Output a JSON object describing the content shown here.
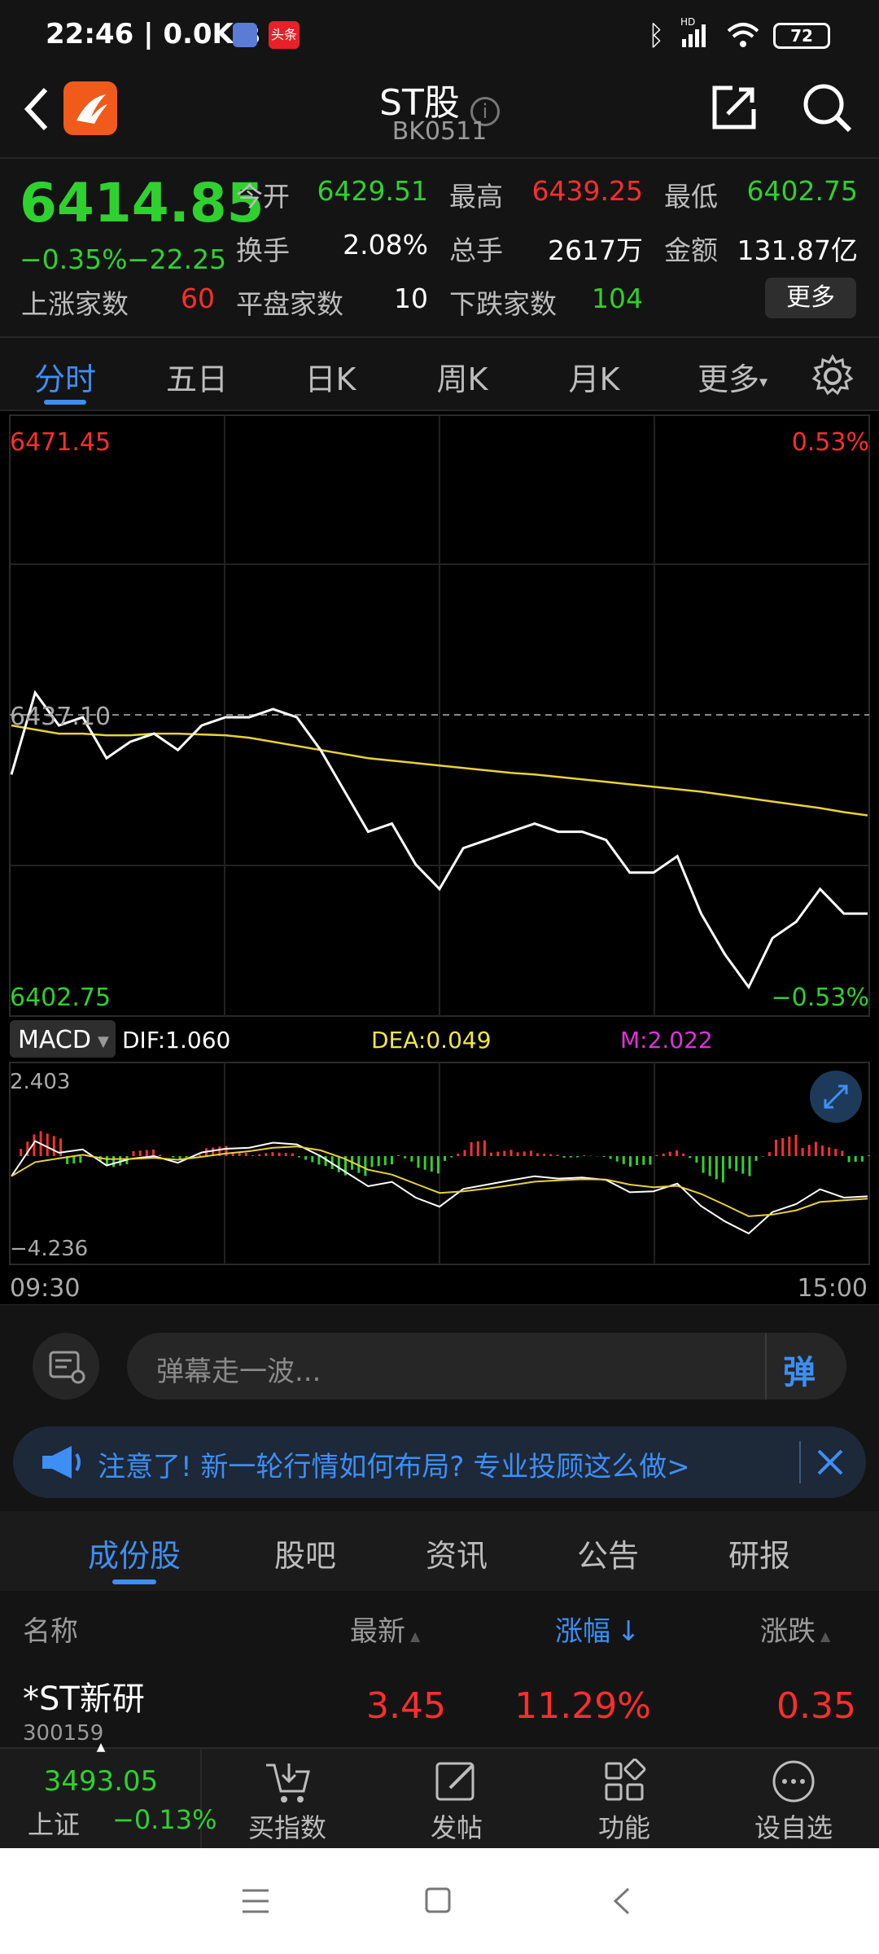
{
  "status_bar": {
    "time": "22:46",
    "speed": "0.0K/s",
    "app_badge": "头条",
    "battery": "72",
    "bluetooth_icon": "bluetooth-icon",
    "signal_icon": "signal-icon",
    "hd_label": "HD",
    "wifi_icon": "wifi-icon"
  },
  "header": {
    "title": "ST股",
    "code": "BK0511",
    "back_icon": "back-arrow-icon",
    "logo_icon": "app-logo-icon",
    "info_icon": "info-icon",
    "share_icon": "share-icon",
    "search_icon": "search-icon"
  },
  "quote": {
    "price": "6414.85",
    "change_pct": "−0.35%",
    "change": "−22.25",
    "open_label": "今开",
    "open": "6429.51",
    "high_label": "最高",
    "high": "6439.25",
    "low_label": "最低",
    "low": "6402.75",
    "turnover_label": "换手",
    "turnover": "2.08%",
    "volume_label": "总手",
    "volume": "2617万",
    "amount_label": "金额",
    "amount": "131.87亿",
    "up_label": "上涨家数",
    "up": "60",
    "flat_label": "平盘家数",
    "flat": "10",
    "down_label": "下跌家数",
    "down": "104",
    "more_button": "更多"
  },
  "tabs": {
    "items": [
      "分时",
      "五日",
      "日K",
      "周K",
      "月K",
      "更多"
    ],
    "active": 0,
    "settings_icon": "gear-icon"
  },
  "chart": {
    "max_price": "6471.45",
    "max_pct": "0.53%",
    "prev_close": "6437.10",
    "min_price": "6402.75",
    "min_pct": "−0.53%",
    "macd_label": "MACD",
    "dif": "DIF:1.060",
    "dea": "DEA:0.049",
    "m": "M:2.022",
    "macd_max": "2.403",
    "macd_min": "−4.236",
    "time_start": "09:30",
    "time_end": "15:00",
    "expand_icon": "expand-icon"
  },
  "chart_data": {
    "type": "line",
    "x_range": [
      "09:30",
      "15:00"
    ],
    "ylim": [
      6402.75,
      6471.45
    ],
    "reference_line": 6437.1,
    "series": [
      {
        "values": [
          6430,
          6440,
          6436,
          6437,
          6432,
          6434,
          6435,
          6433,
          6436,
          6437,
          6437,
          6438,
          6437,
          6433,
          6428,
          6423,
          6424,
          6419,
          6416,
          6421,
          6422,
          6423,
          6424,
          6423,
          6423,
          6422,
          6418,
          6418,
          6420,
          6413,
          6408,
          6404,
          6410,
          6412,
          6416,
          6413,
          6413
        ]
      },
      {
        "values": [
          6436,
          6435.5,
          6435,
          6435,
          6434.8,
          6434.8,
          6435,
          6435,
          6434.9,
          6434.8,
          6434.5,
          6434,
          6433.5,
          6433,
          6432.5,
          6432,
          6431.7,
          6431.4,
          6431.1,
          6430.8,
          6430.5,
          6430.2,
          6430,
          6429.7,
          6429.4,
          6429.1,
          6428.8,
          6428.5,
          6428.2,
          6427.9,
          6427.5,
          6427.1,
          6426.7,
          6426.3,
          6425.9,
          6425.4,
          6425
        ]
      }
    ]
  },
  "danmu": {
    "placeholder": "弹幕走一波...",
    "send_label": "弹",
    "chat_icon": "chat-settings-icon"
  },
  "notice": {
    "text": "注意了! 新一轮行情如何布局? 专业投顾这么做>",
    "megaphone_icon": "megaphone-icon",
    "close_icon": "close-icon"
  },
  "subtabs": {
    "items": [
      "成份股",
      "股吧",
      "资讯",
      "公告",
      "研报"
    ],
    "active": 0
  },
  "table": {
    "headers": {
      "name": "名称",
      "latest": "最新",
      "change_pct": "涨幅",
      "change": "涨跌"
    },
    "rows": [
      {
        "name": "*ST新研",
        "code": "300159",
        "latest": "3.45",
        "change_pct": "11.29%",
        "change": "0.35"
      }
    ]
  },
  "bottom_bar": {
    "index_value": "3493.05",
    "index_name": "上证",
    "index_change": "−0.13%",
    "items": [
      {
        "label": "买指数",
        "icon": "cart-icon"
      },
      {
        "label": "发帖",
        "icon": "edit-icon"
      },
      {
        "label": "功能",
        "icon": "grid-icon"
      },
      {
        "label": "设自选",
        "icon": "more-dots-icon"
      }
    ]
  },
  "nav": {
    "menu_icon": "menu-icon",
    "home_icon": "home-icon",
    "back_icon": "nav-back-icon"
  },
  "colors": {
    "up": "#ff2e2e",
    "down": "#2fd12f",
    "accent": "#3d8ff5",
    "price_line": "#ffffff",
    "avg_line": "#e8d23a",
    "dea_color": "#f2e64a",
    "m_color": "#e030e0"
  }
}
